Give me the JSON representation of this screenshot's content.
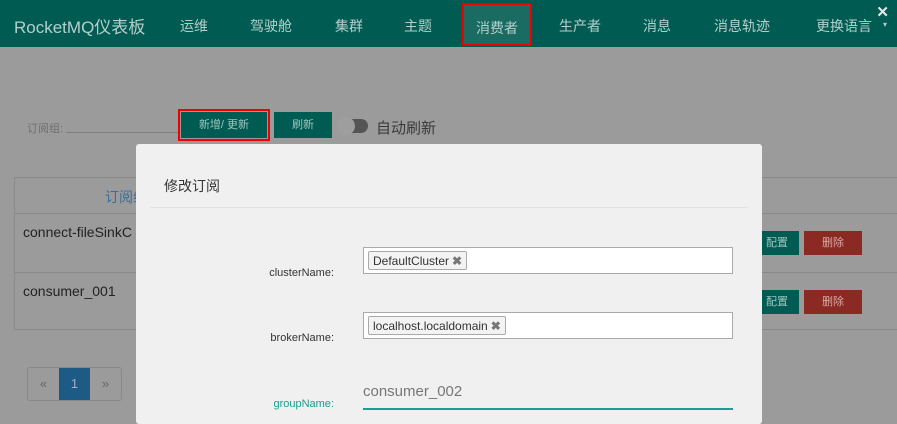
{
  "header": {
    "brand": "RocketMQ仪表板",
    "nav": [
      "运维",
      "驾驶舱",
      "集群",
      "主题",
      "消费者",
      "生产者",
      "消息",
      "消息轨迹",
      "更换语言"
    ],
    "active": "消费者",
    "close": "✕",
    "caret": "▾"
  },
  "toolbar": {
    "label": "订阅组:",
    "add_update": "新增/ 更新",
    "refresh": "刷新",
    "auto_refresh": "自动刷新",
    "auto_refresh_on": false
  },
  "table": {
    "header": "订阅组",
    "rows": [
      {
        "group": "connect-fileSinkC"
      },
      {
        "group": "consumer_001"
      }
    ],
    "config": "配置",
    "delete": "删除"
  },
  "pager": {
    "prev": "«",
    "page": "1",
    "next": "»"
  },
  "modal": {
    "title": "修改订阅",
    "fields": {
      "clusterName": {
        "label": "clusterName:",
        "tags": [
          "DefaultCluster"
        ]
      },
      "brokerName": {
        "label": "brokerName:",
        "tags": [
          "localhost.localdomain"
        ]
      },
      "groupName": {
        "label": "groupName:",
        "value": "consumer_002"
      }
    },
    "remove": "✖"
  },
  "colors": {
    "header": "#005c52",
    "accent": "#1aa08f",
    "danger": "#8a2a22",
    "highlight": "#ee0000"
  }
}
